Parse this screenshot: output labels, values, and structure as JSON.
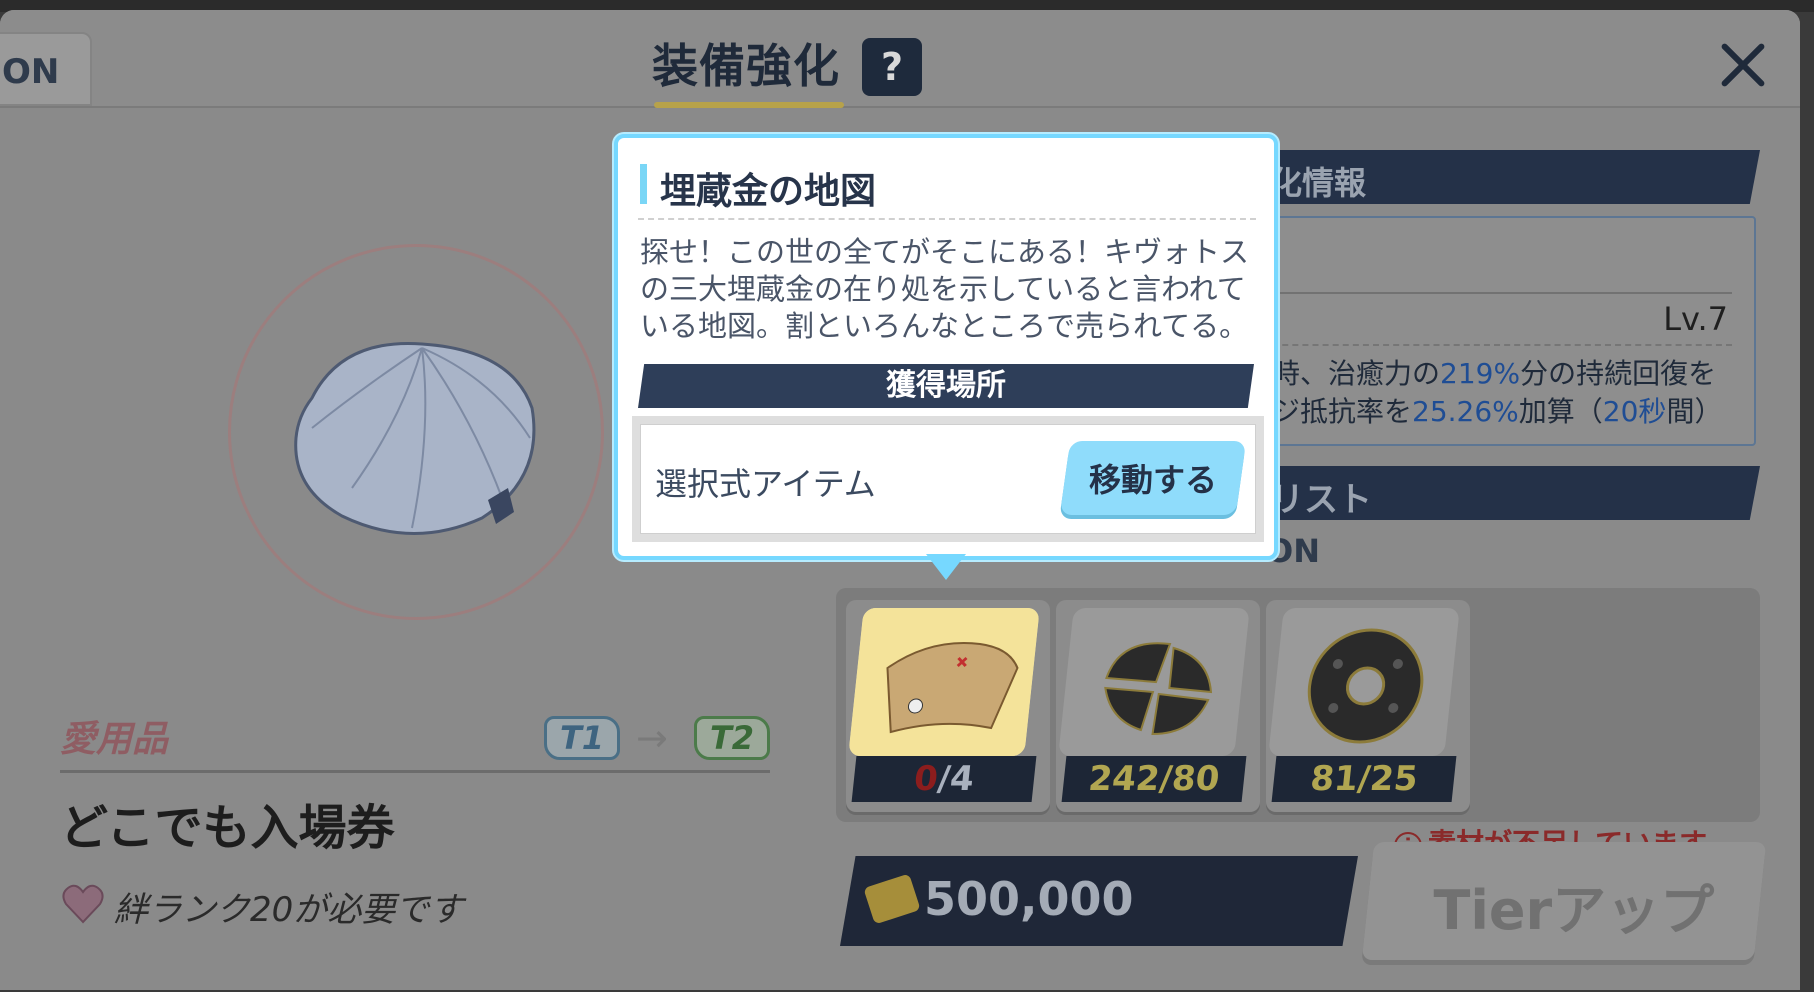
{
  "header": {
    "left_tab": "ON",
    "title": "装備強化",
    "help": "?"
  },
  "item": {
    "category": "愛用品",
    "tier_from": "T1",
    "tier_to": "T2",
    "name": "どこでも入場券",
    "requirement": "絆ランク20が必要です"
  },
  "info": {
    "header": "化情報",
    "level": "Lv.7",
    "line1_a": "時、治癒力の",
    "line1_hl": "219%",
    "line1_b": "分の持続回復を",
    "line2_a": "ジ抵抗率を",
    "line2_hl1": "25.26%",
    "line2_b": "加算（",
    "line2_hl2": "20秒",
    "line2_c": "間）"
  },
  "list": {
    "header": "リスト",
    "sub": "ON"
  },
  "materials": [
    {
      "have": "0",
      "need": "/4"
    },
    {
      "count": "242/80"
    },
    {
      "count": "81/25"
    }
  ],
  "warning": "素材が不足しています。",
  "cost": "500,000",
  "tier_up_button": "Tierアップ",
  "popup": {
    "title": "埋蔵金の地図",
    "description": "探せ！この世の全てがそこにある！キヴォトスの三大埋蔵金の在り処を示していると言われている地図。割といろんなところで売られてる。",
    "acquisition_header": "獲得場所",
    "source_label": "選択式アイテム",
    "go_button": "移動する"
  }
}
